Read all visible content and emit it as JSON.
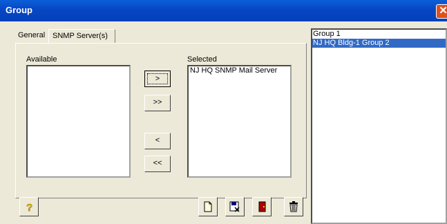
{
  "window": {
    "title": "Group"
  },
  "tabs": [
    {
      "label": "General"
    },
    {
      "label": "SNMP Server(s)"
    }
  ],
  "available": {
    "label": "Available",
    "items": []
  },
  "selected": {
    "label": "Selected",
    "items": [
      {
        "label": "NJ HQ SNMP Mail Server"
      }
    ]
  },
  "transfer_buttons": {
    "add_one": ">",
    "add_all": ">>",
    "remove_one": "<",
    "remove_all": "<<"
  },
  "groups": [
    {
      "label": "Group 1",
      "selected": false
    },
    {
      "label": "NJ HQ Bldg-1 Group 2",
      "selected": true
    }
  ],
  "colors": {
    "titlebar": "#0A5FD8",
    "selection": "#316AC5",
    "close": "#E0501F"
  },
  "icons": [
    "help-icon",
    "new-document-icon",
    "save-icon",
    "exit-door-icon",
    "trash-icon",
    "close-icon"
  ]
}
